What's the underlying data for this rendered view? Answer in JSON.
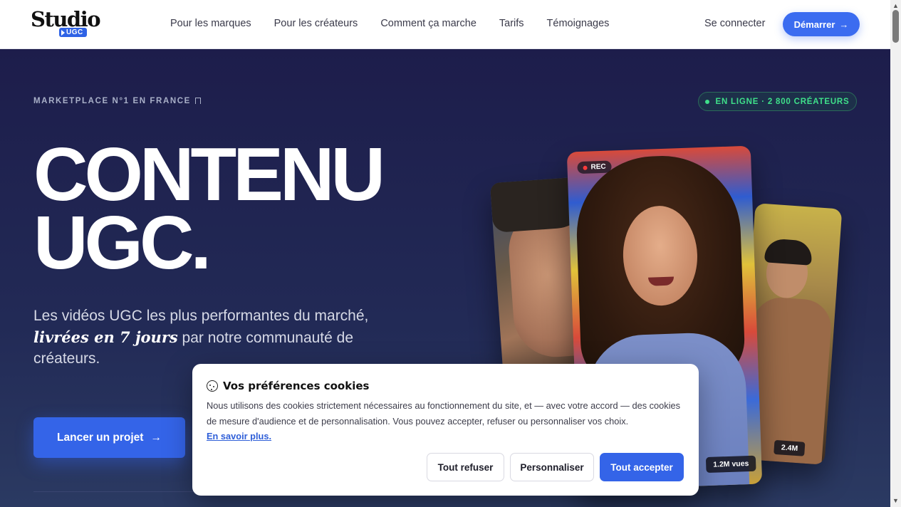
{
  "header": {
    "logo_text": "Studio",
    "logo_badge": "UGC",
    "nav": [
      "Pour les marques",
      "Pour les créateurs",
      "Comment ça marche",
      "Tarifs",
      "Témoignages"
    ],
    "login": "Se connecter",
    "start": "Démarrer",
    "start_arrow": "→"
  },
  "hero": {
    "eyebrow": "MARKETPLACE N°1 EN FRANCE",
    "online": "EN LIGNE · 2 800 CRÉATEURS",
    "title_line1": "CONTENU",
    "title_line2": "UGC.",
    "subtitle_a": "Les vidéos UGC les plus performantes du marché,",
    "subtitle_em": "livrées en 7 jours",
    "subtitle_b": " par notre communauté de créateurs.",
    "cta": "Lancer un projet",
    "cta_arrow": "→",
    "rec": "REC",
    "views_main": "1.2M vues",
    "views_right": "2.4M"
  },
  "cookie": {
    "title": "Vos préférences cookies",
    "text": "Nous utilisons des cookies strictement nécessaires au fonctionnement du site, et — avec votre accord — des cookies de mesure d'audience et de personnalisation. Vous pouvez accepter, refuser ou personnaliser vos choix.",
    "link": "En savoir plus.",
    "refuse": "Tout refuser",
    "customize": "Personnaliser",
    "accept": "Tout accepter"
  },
  "colors": {
    "accent": "#3464e8",
    "hero_bg": "#1d1d4b",
    "online_green": "#3fe08a"
  }
}
